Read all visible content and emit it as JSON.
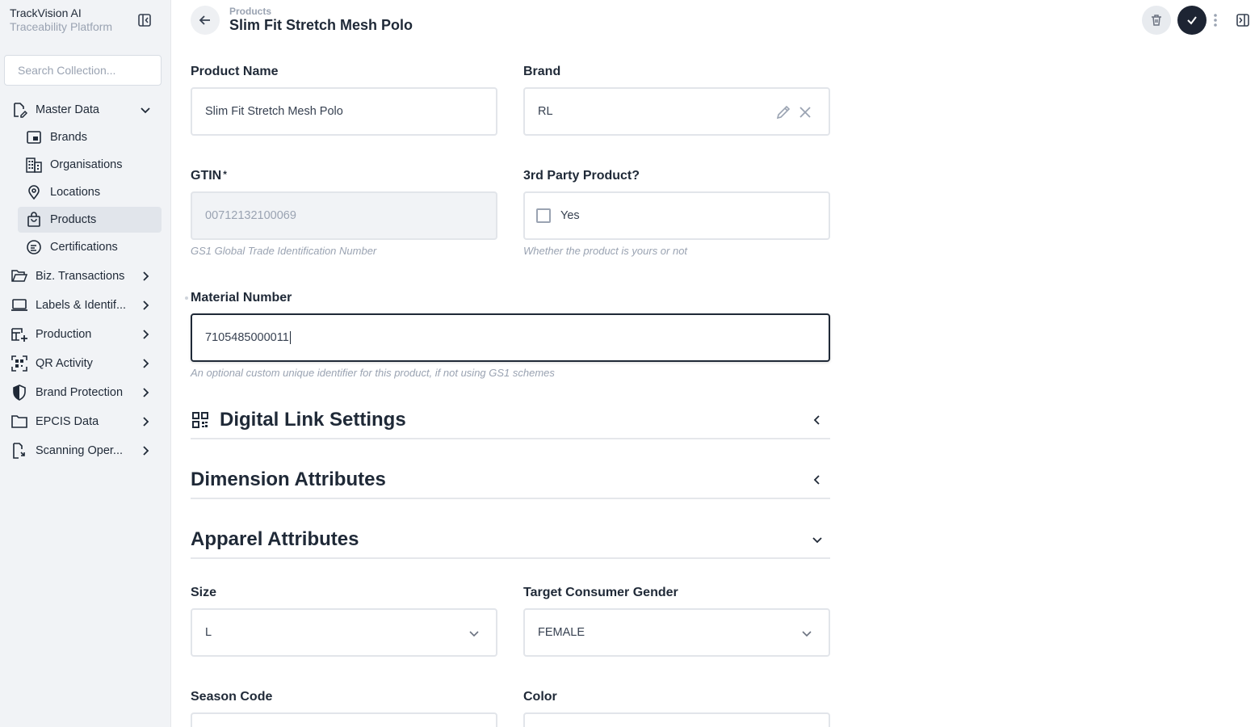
{
  "sidebar": {
    "app_title": "TrackVision AI",
    "app_subtitle": "Traceability Platform",
    "search_placeholder": "Search Collection...",
    "master_data": "Master Data",
    "sub_items": [
      "Brands",
      "Organisations",
      "Locations",
      "Products",
      "Certifications"
    ],
    "groups": [
      "Biz. Transactions",
      "Labels & Identif...",
      "Production",
      "QR Activity",
      "Brand Protection",
      "EPCIS Data",
      "Scanning Oper..."
    ]
  },
  "header": {
    "breadcrumb": "Products",
    "title": "Slim Fit Stretch Mesh Polo"
  },
  "form": {
    "product_name_label": "Product Name",
    "product_name_value": "Slim Fit Stretch Mesh Polo",
    "brand_label": "Brand",
    "brand_value": "RL",
    "gtin_label": "GTIN",
    "gtin_required": "*",
    "gtin_value": "00712132100069",
    "gtin_hint": "GS1 Global Trade Identification Number",
    "third_party_label": "3rd Party Product?",
    "third_party_option": "Yes",
    "third_party_hint": "Whether the product is yours or not",
    "material_label": "Material Number",
    "material_value": "7105485000011",
    "material_hint": "An optional custom unique identifier for this product, if not using GS1 schemes",
    "size_label": "Size",
    "size_value": "L",
    "gender_label": "Target Consumer Gender",
    "gender_value": "FEMALE",
    "season_label": "Season Code",
    "color_label": "Color"
  },
  "sections": {
    "digital_link": "Digital Link Settings",
    "dimension": "Dimension Attributes",
    "apparel": "Apparel Attributes"
  },
  "colors": {
    "primary_dark": "#1d2433",
    "sidebar_bg": "#f1f3f6",
    "muted_text": "#9aa3b2"
  }
}
